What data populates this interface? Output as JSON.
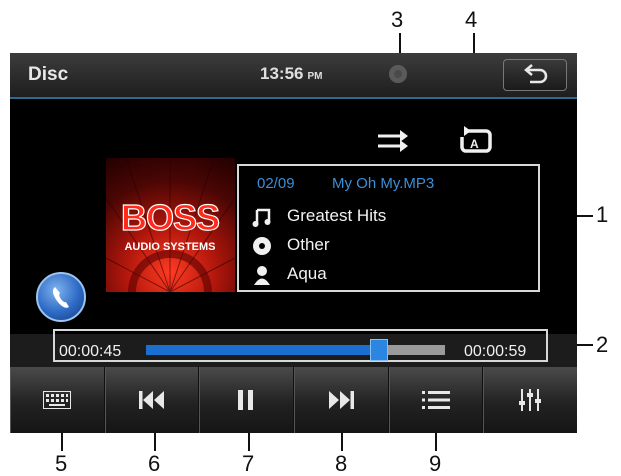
{
  "header": {
    "title": "Disc",
    "clock": "13:56",
    "clock_ampm": "PM"
  },
  "track_info": {
    "track_number": "02/09",
    "file_name": "My Oh My.MP3",
    "album": "Greatest Hits",
    "genre": "Other",
    "artist": "Aqua"
  },
  "album_art": {
    "brand": "BOSS",
    "subtitle": "AUDIO SYSTEMS"
  },
  "progress": {
    "elapsed": "00:00:45",
    "total": "00:00:59",
    "fraction": 0.78
  },
  "controls": [
    {
      "name": "keypad-button",
      "icon": "keyboard-icon"
    },
    {
      "name": "previous-track-button",
      "icon": "skip-previous-icon"
    },
    {
      "name": "pause-button",
      "icon": "pause-icon"
    },
    {
      "name": "next-track-button",
      "icon": "skip-next-icon"
    },
    {
      "name": "playlist-button",
      "icon": "list-icon"
    },
    {
      "name": "equalizer-button",
      "icon": "equalizer-icon"
    }
  ],
  "callouts": {
    "shuffle": "3",
    "repeat": "4",
    "info": "1",
    "progress": "2",
    "keypad": "5",
    "previous": "6",
    "pause": "7",
    "next": "8",
    "playlist": "9"
  },
  "colors": {
    "accent_blue": "#2a86e0",
    "track_number_blue": "#3a8fd8",
    "background": "#000000"
  }
}
